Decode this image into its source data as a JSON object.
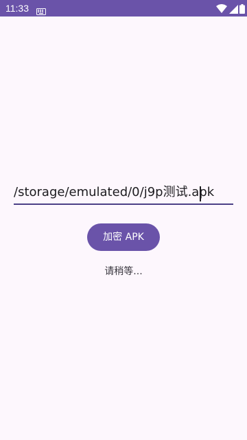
{
  "status_bar": {
    "time": "11:33",
    "background_color": "#6a53a9",
    "icons": [
      "keyboard-icon",
      "wifi-icon",
      "signal-icon",
      "battery-icon"
    ]
  },
  "path_field": {
    "value": "/storage/emulated/0/j9p测试.apk",
    "underline_color": "#4b3f86"
  },
  "encrypt_button": {
    "label": "加密 APK",
    "color": "#6a53a9"
  },
  "status_message": "请稍等...",
  "colors": {
    "background": "#fdf7fd",
    "primary": "#6a53a9",
    "text": "#1c1b1f"
  }
}
